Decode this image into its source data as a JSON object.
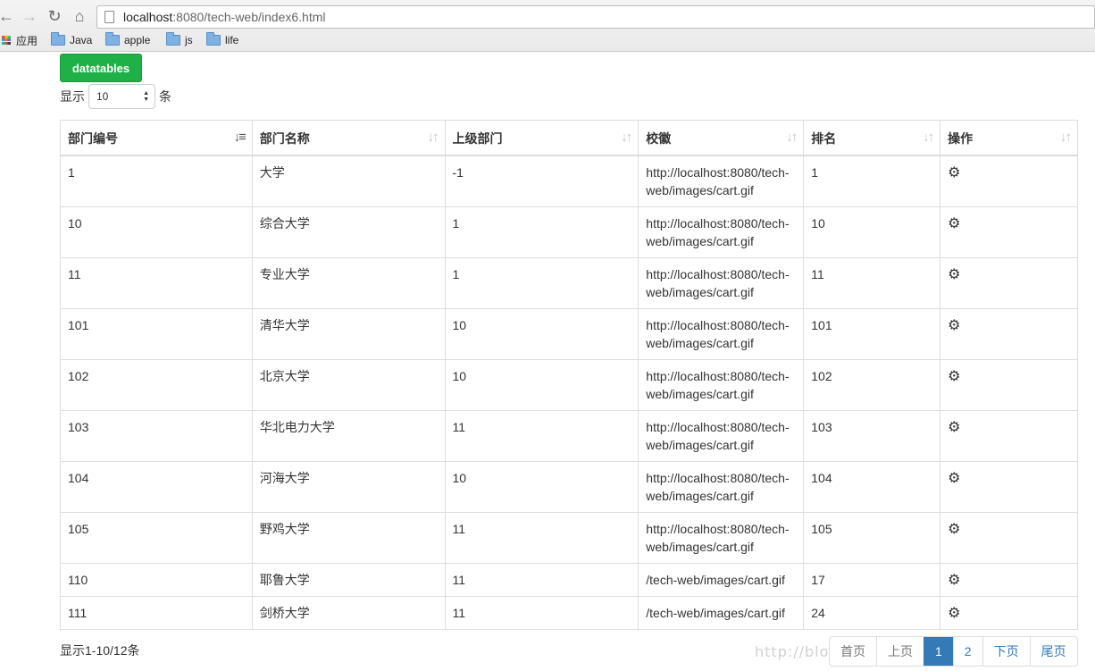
{
  "browser": {
    "address_host": "localhost",
    "address_path": ":8080/tech-web/index6.html",
    "bookmarks": [
      {
        "label": "应用",
        "icon": "apps-grid-icon"
      },
      {
        "label": "Java",
        "icon": "folder-icon"
      },
      {
        "label": "apple",
        "icon": "folder-icon"
      },
      {
        "label": "js",
        "icon": "folder-icon"
      },
      {
        "label": "life",
        "icon": "folder-icon"
      }
    ]
  },
  "toolbar": {
    "datatables_label": "datatables"
  },
  "length": {
    "prefix": "显示",
    "value": "10",
    "suffix": "条"
  },
  "table": {
    "columns": [
      "部门编号",
      "部门名称",
      "上级部门",
      "校徽",
      "排名",
      "操作"
    ],
    "sorted_column": "部门编号",
    "rows": [
      {
        "id": "1",
        "name": "大学",
        "parent": "-1",
        "logo": "http://localhost:8080/tech-web/images/cart.gif",
        "rank": "1"
      },
      {
        "id": "10",
        "name": "综合大学",
        "parent": "1",
        "logo": "http://localhost:8080/tech-web/images/cart.gif",
        "rank": "10"
      },
      {
        "id": "11",
        "name": "专业大学",
        "parent": "1",
        "logo": "http://localhost:8080/tech-web/images/cart.gif",
        "rank": "11"
      },
      {
        "id": "101",
        "name": "清华大学",
        "parent": "10",
        "logo": "http://localhost:8080/tech-web/images/cart.gif",
        "rank": "101"
      },
      {
        "id": "102",
        "name": "北京大学",
        "parent": "10",
        "logo": "http://localhost:8080/tech-web/images/cart.gif",
        "rank": "102"
      },
      {
        "id": "103",
        "name": "华北电力大学",
        "parent": "11",
        "logo": "http://localhost:8080/tech-web/images/cart.gif",
        "rank": "103"
      },
      {
        "id": "104",
        "name": "河海大学",
        "parent": "10",
        "logo": "http://localhost:8080/tech-web/images/cart.gif",
        "rank": "104"
      },
      {
        "id": "105",
        "name": "野鸡大学",
        "parent": "11",
        "logo": "http://localhost:8080/tech-web/images/cart.gif",
        "rank": "105"
      },
      {
        "id": "110",
        "name": "耶鲁大学",
        "parent": "11",
        "logo": "/tech-web/images/cart.gif",
        "rank": "17"
      },
      {
        "id": "111",
        "name": "剑桥大学",
        "parent": "11",
        "logo": "/tech-web/images/cart.gif",
        "rank": "24"
      }
    ]
  },
  "footer": {
    "info": "显示1-10/12条",
    "watermark": "http://blog.csdn.net/csdnfangyiliang",
    "pages": [
      {
        "label": "首页",
        "state": "disabled"
      },
      {
        "label": "上页",
        "state": "disabled"
      },
      {
        "label": "1",
        "state": "active"
      },
      {
        "label": "2",
        "state": "normal"
      },
      {
        "label": "下页",
        "state": "normal"
      },
      {
        "label": "尾页",
        "state": "normal"
      }
    ]
  }
}
